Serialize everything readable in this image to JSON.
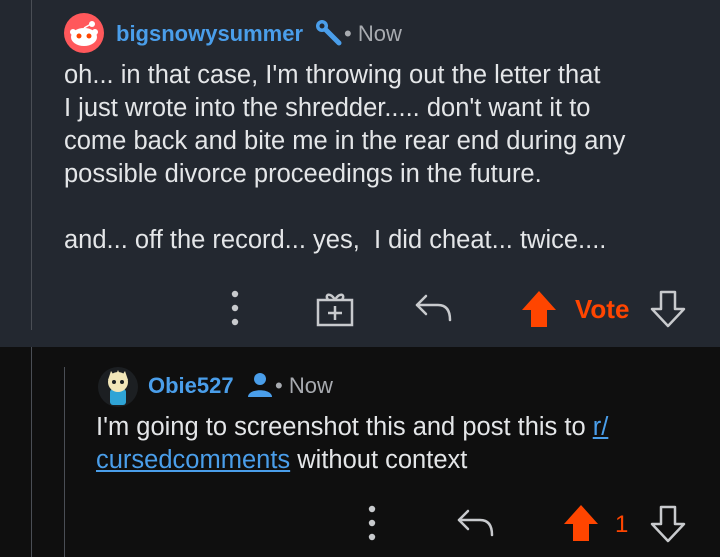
{
  "comment1": {
    "username": "bigsnowysummer",
    "separator": "•",
    "time": "Now",
    "body": "oh... in that case, I'm throwing out the letter that\nI just wrote into the shredder..... don't want it to\ncome back and bite me in the rear end during any\npossible divorce proceedings in the future.\n\nand... off the record... yes,  I did cheat... twice....",
    "actions": {
      "vote_label": "Vote"
    },
    "icons": [
      "snoo-avatar-icon",
      "mod-wrench-icon",
      "more-icon",
      "gift-icon",
      "reply-icon",
      "upvote-icon",
      "downvote-icon"
    ]
  },
  "comment2": {
    "username": "Obie527",
    "separator": "•",
    "time": "Now",
    "body_prefix": "I'm going to screenshot this and post this to ",
    "link_part1": "r/",
    "link_part2": "cursedcomments",
    "body_suffix": " without context",
    "actions": {
      "score": "1"
    },
    "icons": [
      "user-avatar-icon",
      "op-person-icon",
      "more-icon",
      "reply-icon",
      "upvote-icon",
      "downvote-icon"
    ]
  },
  "colors": {
    "accent": "#ff4500",
    "link": "#4a9eea",
    "panel_top": "#232830",
    "panel_bottom": "#0f0f0f"
  }
}
